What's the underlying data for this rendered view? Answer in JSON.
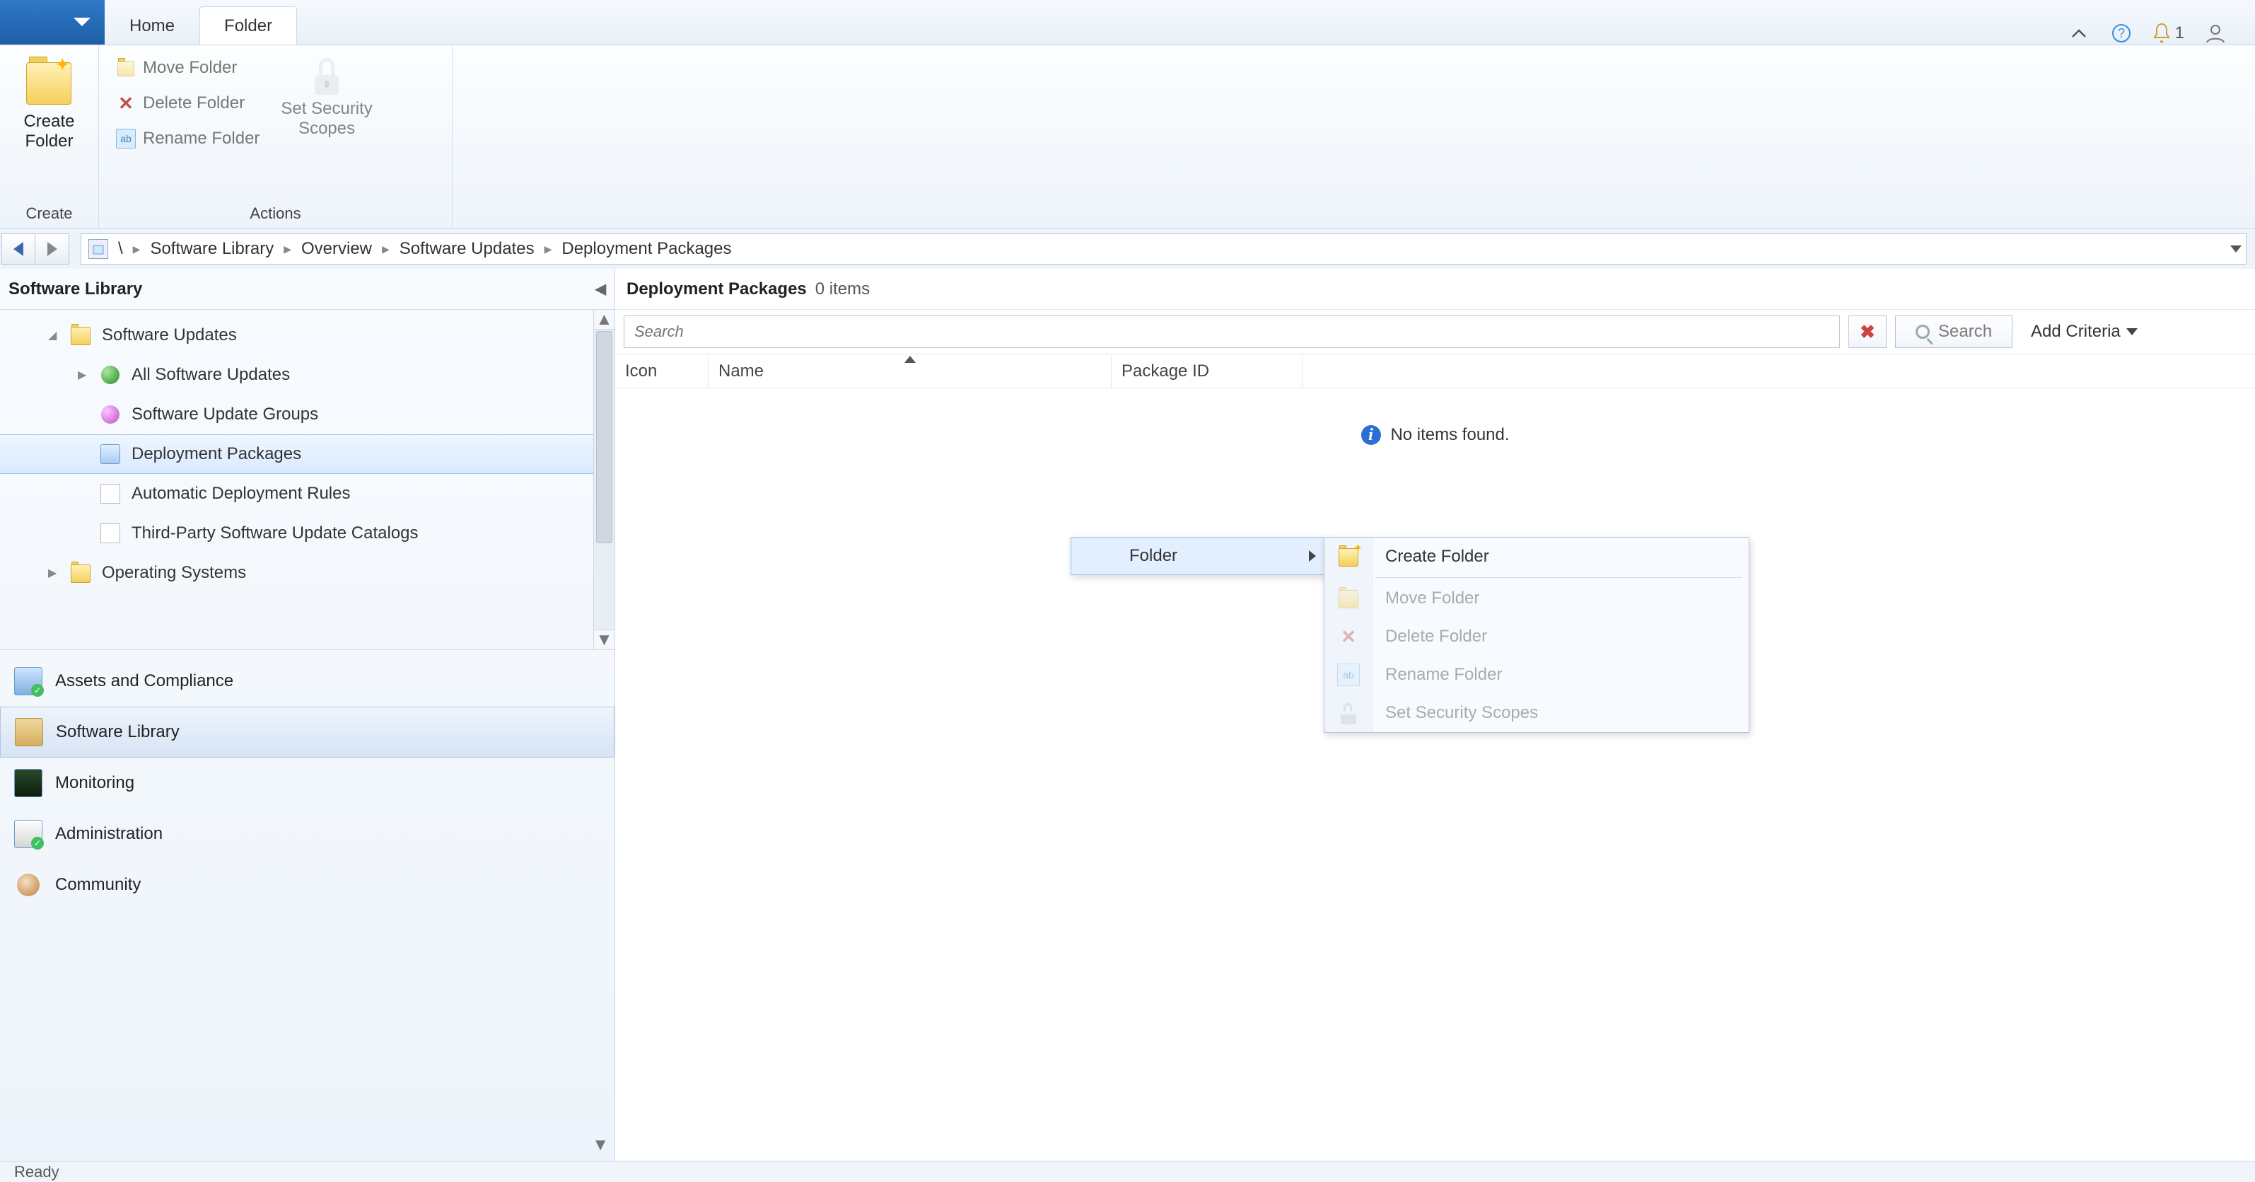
{
  "ribbon": {
    "tabs": {
      "home": "Home",
      "folder": "Folder"
    },
    "notify_count": "1",
    "groups": {
      "create": {
        "label": "Create",
        "create_folder": "Create\nFolder"
      },
      "actions": {
        "label": "Actions",
        "move": "Move Folder",
        "delete": "Delete Folder",
        "rename": "Rename Folder",
        "scopes": "Set Security\nScopes"
      }
    }
  },
  "breadcrumb": {
    "root": "\\",
    "items": [
      "Software Library",
      "Overview",
      "Software Updates",
      "Deployment Packages"
    ]
  },
  "left": {
    "title": "Software Library",
    "tree": {
      "software_updates": "Software Updates",
      "all_updates": "All Software Updates",
      "update_groups": "Software Update Groups",
      "deployment_packages": "Deployment Packages",
      "adr": "Automatic Deployment Rules",
      "thirdparty": "Third-Party Software Update Catalogs",
      "operating_systems": "Operating Systems"
    },
    "nav": {
      "assets": "Assets and Compliance",
      "software_library": "Software Library",
      "monitoring": "Monitoring",
      "administration": "Administration",
      "community": "Community"
    }
  },
  "content": {
    "title": "Deployment Packages",
    "count_suffix": "0 items",
    "search_placeholder": "Search",
    "search_button": "Search",
    "add_criteria": "Add Criteria",
    "columns": {
      "icon": "Icon",
      "name": "Name",
      "pkgid": "Package ID"
    },
    "empty": "No items found."
  },
  "context": {
    "folder": "Folder",
    "sub": {
      "create": "Create Folder",
      "move": "Move Folder",
      "delete": "Delete Folder",
      "rename": "Rename Folder",
      "scopes": "Set Security Scopes"
    }
  },
  "status": "Ready"
}
